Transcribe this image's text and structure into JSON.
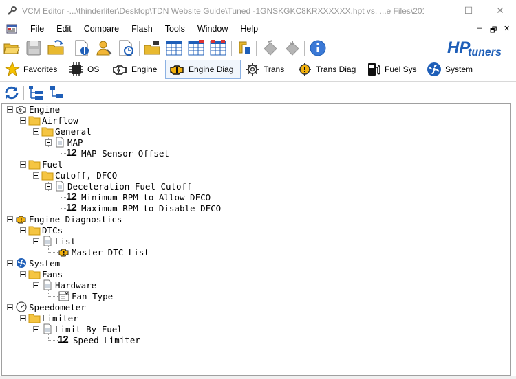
{
  "window": {
    "title": "VCM Editor -...\\thinderliter\\Desktop\\TDN Website Guide\\Tuned -1GNSKGKC8KRXXXXXX.hpt vs. ...e Files\\2015...",
    "minimize": "—",
    "maximize": "☐",
    "close": "✕"
  },
  "menu": {
    "items": [
      "File",
      "Edit",
      "Compare",
      "Flash",
      "Tools",
      "Window",
      "Help"
    ],
    "mdi_min": "–",
    "mdi_restore": "🗗",
    "mdi_close": "✕"
  },
  "logo": {
    "brand": "HP",
    "text": "tuners"
  },
  "nav": {
    "tabs": [
      {
        "label": "Favorites",
        "icon": "star-icon"
      },
      {
        "label": "OS",
        "icon": "chip-icon"
      },
      {
        "label": "Engine",
        "icon": "engine-icon"
      },
      {
        "label": "Engine Diag",
        "icon": "engine-diag-icon",
        "active": true
      },
      {
        "label": "Trans",
        "icon": "gear-icon"
      },
      {
        "label": "Trans Diag",
        "icon": "trans-diag-icon"
      },
      {
        "label": "Fuel Sys",
        "icon": "fuel-pump-icon"
      },
      {
        "label": "System",
        "icon": "fan-icon"
      }
    ]
  },
  "tree": {
    "engine": "Engine",
    "airflow": "Airflow",
    "general": "General",
    "map": "MAP",
    "map_offset": "MAP Sensor Offset",
    "fuel": "Fuel",
    "cutoff": "Cutoff, DFCO",
    "decel": "Deceleration Fuel Cutoff",
    "min_rpm": "Minimum RPM to Allow DFCO",
    "max_rpm": "Maximum RPM to Disable DFCO",
    "engine_diag": "Engine Diagnostics",
    "dtcs": "DTCs",
    "list": "List",
    "master_dtc": "Master DTC List",
    "system": "System",
    "fans": "Fans",
    "hardware": "Hardware",
    "fan_type": "Fan Type",
    "speedometer": "Speedometer",
    "limiter": "Limiter",
    "limit_by_fuel": "Limit By Fuel",
    "speed_limiter": "Speed Limiter",
    "param_glyph": "12"
  },
  "colors": {
    "folder": "#f5c542",
    "accent": "#1f5fb8",
    "active_tab_border": "#8db2e3"
  }
}
